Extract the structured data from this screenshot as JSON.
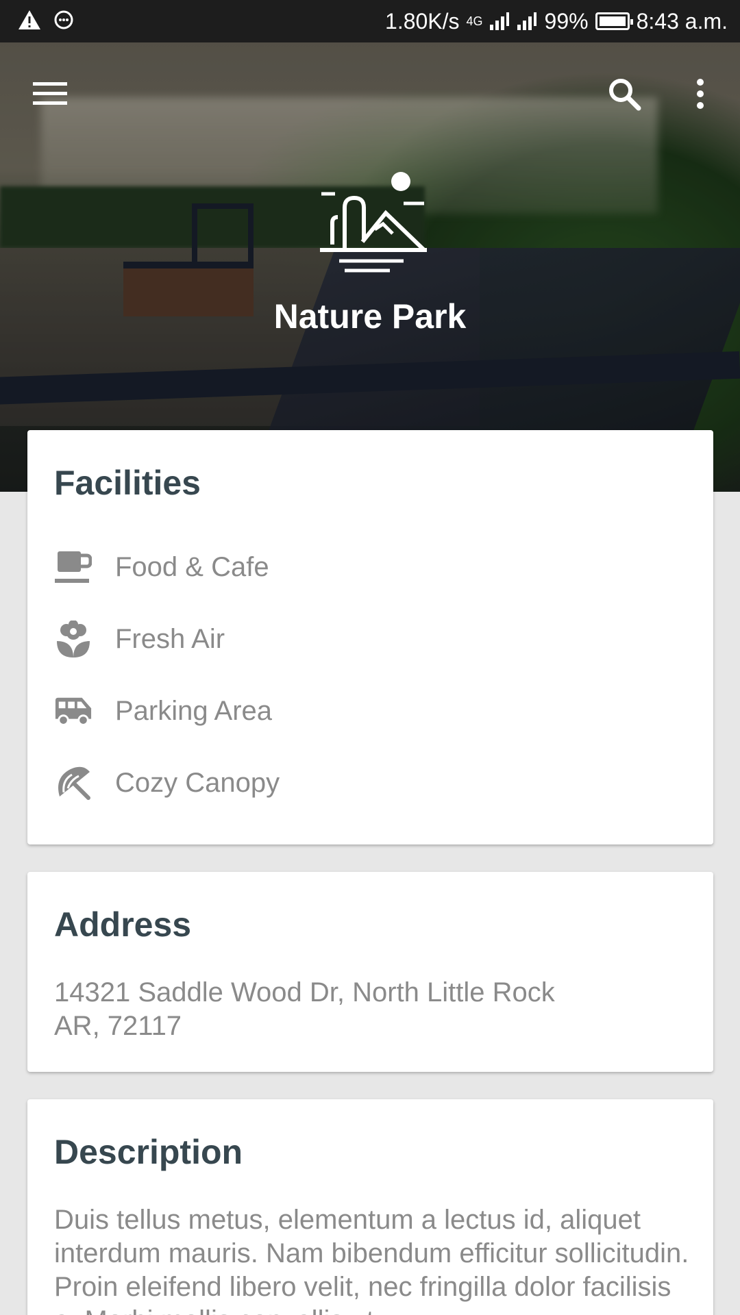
{
  "status_bar": {
    "speed": "1.80K/s",
    "network": "4G",
    "battery": "99%",
    "time": "8:43 a.m."
  },
  "app_bar": {
    "menu_icon": "menu-icon",
    "search_icon": "search-icon",
    "overflow_icon": "more-vert-icon"
  },
  "hero": {
    "title": "Nature Park",
    "logo_icon": "park-landscape-icon"
  },
  "facilities": {
    "title": "Facilities",
    "items": [
      {
        "icon": "cafe-icon",
        "label": "Food & Cafe"
      },
      {
        "icon": "flower-icon",
        "label": "Fresh Air"
      },
      {
        "icon": "van-icon",
        "label": "Parking Area"
      },
      {
        "icon": "umbrella-icon",
        "label": "Cozy Canopy"
      }
    ]
  },
  "address": {
    "title": "Address",
    "line1": "14321 Saddle Wood Dr, North Little Rock",
    "line2": "AR, 72117"
  },
  "description": {
    "title": "Description",
    "text": "Duis tellus metus, elementum a lectus id, aliquet interdum mauris. Nam bibendum efficitur sollicitudin. Proin eleifend libero velit, nec fringilla dolor facilisis a. Morbi mollis convallis ut."
  }
}
